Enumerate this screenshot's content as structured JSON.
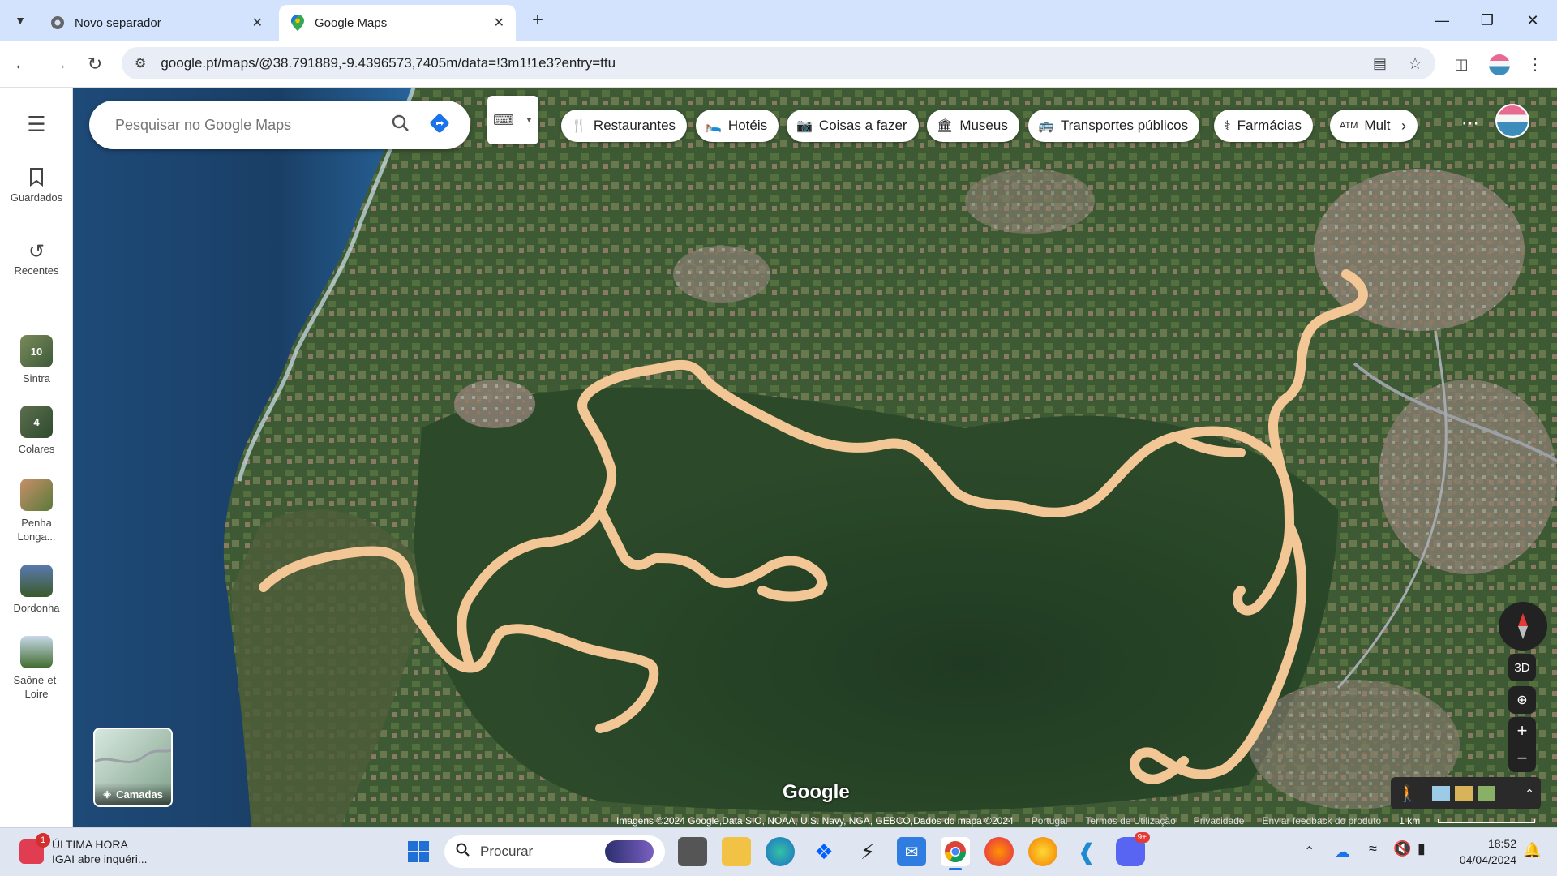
{
  "browser": {
    "tabs": [
      {
        "title": "Novo separador",
        "active": false
      },
      {
        "title": "Google Maps",
        "active": true
      }
    ],
    "url": "google.pt/maps/@38.791889,-9.4396573,7405m/data=!3m1!1e3?entry=ttu"
  },
  "rail": {
    "saved_label": "Guardados",
    "recent_label": "Recentes",
    "places": [
      {
        "label": "Sintra",
        "badge": "10"
      },
      {
        "label": "Colares",
        "badge": "4"
      },
      {
        "label": "Penha Longa...",
        "badge": ""
      },
      {
        "label": "Dordonha",
        "badge": ""
      },
      {
        "label": "Saône-et-Loire",
        "badge": ""
      }
    ]
  },
  "search": {
    "placeholder": "Pesquisar no Google Maps"
  },
  "chips": [
    {
      "label": "Restaurantes",
      "icon": "fork-knife-icon"
    },
    {
      "label": "Hotéis",
      "icon": "bed-icon"
    },
    {
      "label": "Coisas a fazer",
      "icon": "camera-icon"
    },
    {
      "label": "Museus",
      "icon": "museum-icon"
    },
    {
      "label": "Transportes públicos",
      "icon": "bus-icon"
    },
    {
      "label": "Farmácias",
      "icon": "pharmacy-icon"
    },
    {
      "label": "Mult",
      "icon": "atm-icon"
    }
  ],
  "map": {
    "layers_label": "Camadas",
    "brand": "Google",
    "controls": {
      "three_d": "3D",
      "zoom_in": "+",
      "zoom_out": "−"
    },
    "route_color": "#f3c795",
    "attribution": {
      "imagery": "Imagens ©2024 Google,Data SIO, NOAA, U.S. Navy, NGA, GEBCO,Dados do mapa ©2024",
      "country": "Portugal",
      "terms": "Termos de Utilização",
      "privacy": "Privacidade",
      "feedback": "Enviar feedback do produto",
      "scale": "1 km"
    }
  },
  "taskbar": {
    "news_badge": "1",
    "news_title": "ÚLTIMA HORA",
    "news_text": "IGAI abre inquéri...",
    "search_label": "Procurar",
    "discord_badge": "9+",
    "time": "18:52",
    "date": "04/04/2024"
  }
}
